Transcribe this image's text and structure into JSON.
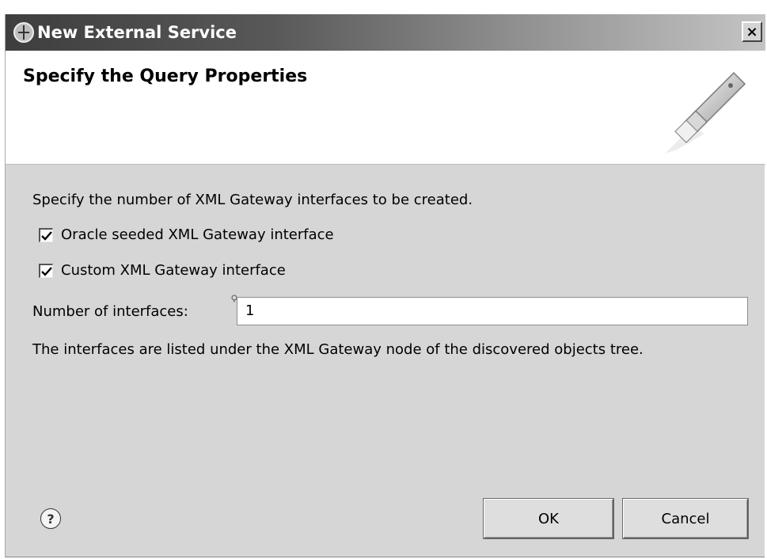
{
  "window": {
    "title": "New External Service",
    "close_label": "×"
  },
  "banner": {
    "title": "Specify the Query Properties"
  },
  "body": {
    "instruction": "Specify the number of XML Gateway interfaces to be created.",
    "checkboxes": [
      {
        "label": "Oracle seeded XML Gateway interface",
        "checked": true
      },
      {
        "label": "Custom XML Gateway interface",
        "checked": true
      }
    ],
    "number_label": "Number of interfaces:",
    "number_value": "1",
    "note": "The interfaces are listed under the XML Gateway node of the discovered objects tree."
  },
  "footer": {
    "help_symbol": "?",
    "ok_label": "OK",
    "cancel_label": "Cancel"
  },
  "icons": {
    "window_icon": "service-icon",
    "banner_graphic": "plug-connector-icon",
    "hint": "content-assist-bulb-icon",
    "help": "help-icon"
  },
  "colors": {
    "dialog_bg": "#d6d6d6",
    "banner_bg": "#ffffff",
    "titlebar_start": "#3e3e3e",
    "titlebar_end": "#c4c4c4"
  }
}
